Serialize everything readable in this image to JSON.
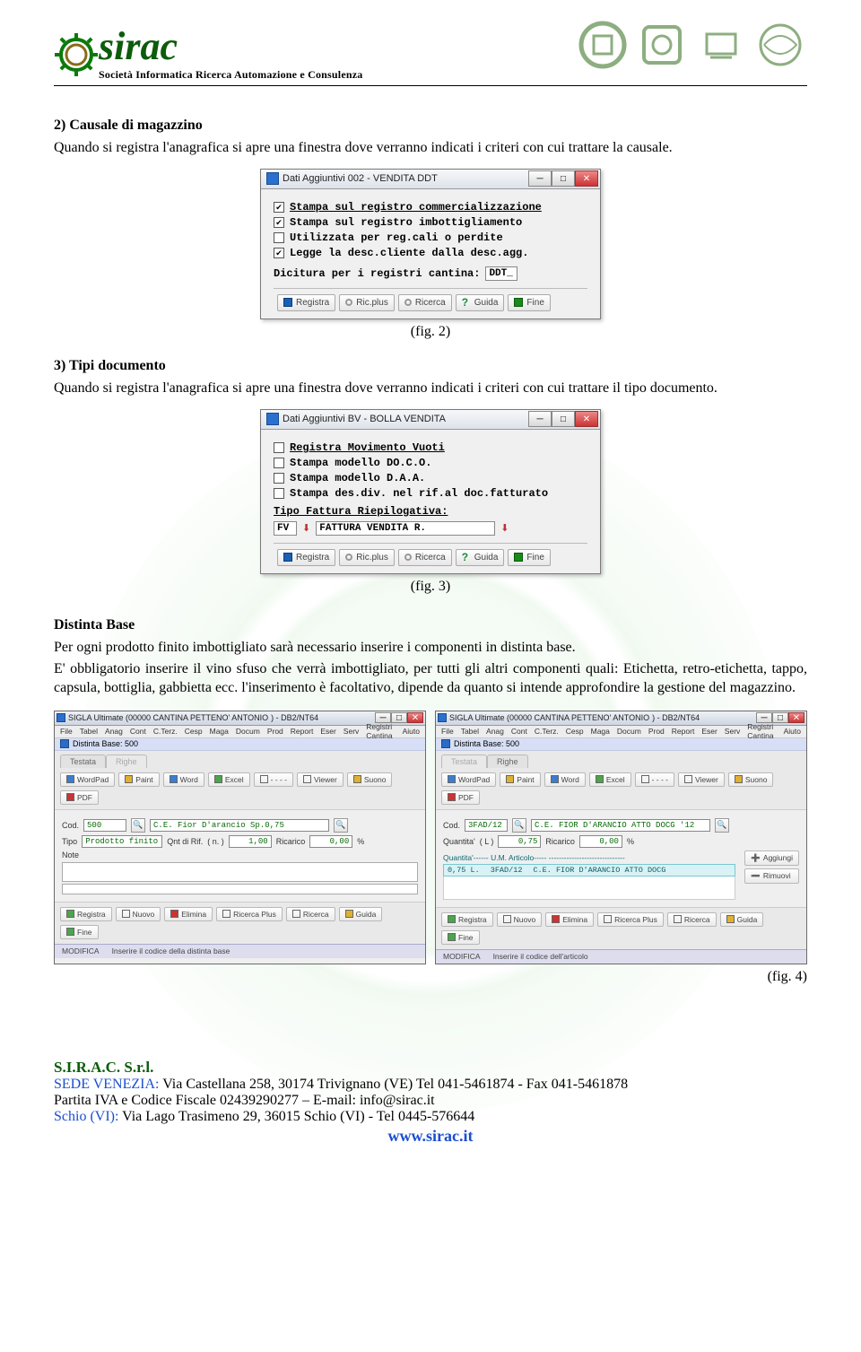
{
  "header": {
    "brand": "sirac",
    "tagline": "Società Informatica Ricerca Automazione e Consulenza"
  },
  "section2": {
    "title": "2)  Causale di magazzino",
    "text": "Quando si registra l'anagrafica si apre una finestra dove verranno indicati i criteri con cui trattare la causale.",
    "fig": "(fig. 2)"
  },
  "section3": {
    "title": "3)  Tipi documento",
    "text": "Quando si registra l'anagrafica si apre una finestra dove verranno indicati i criteri con cui trattare il tipo documento.",
    "fig": "(fig. 3)"
  },
  "distinta": {
    "title": "Distinta Base",
    "p1": "Per ogni prodotto finito imbottigliato sarà necessario inserire i componenti in distinta base.",
    "p2": "E' obbligatorio inserire il vino sfuso che verrà imbottigliato, per tutti gli altri componenti quali: Etichetta, retro-etichetta, tappo, capsula, bottiglia, gabbietta ecc. l'inserimento è facoltativo, dipende da quanto si intende approfondire la gestione del magazzino.",
    "fig": "(fig. 4)"
  },
  "dialog1": {
    "title": "Dati Aggiuntivi 002 - VENDITA DDT",
    "chk1": {
      "label": "Stampa sul registro commercializzazione",
      "checked": true
    },
    "chk2": {
      "label": "Stampa sul registro imbottigliamento",
      "checked": true
    },
    "chk3": {
      "label": "Utilizzata per reg.cali o perdite",
      "checked": false
    },
    "chk4": {
      "label": "Legge la desc.cliente dalla desc.agg.",
      "checked": true
    },
    "dicitura_label": "Dicitura per i registri cantina:",
    "dicitura_value": "DDT_"
  },
  "dialog2": {
    "title": "Dati Aggiuntivi BV - BOLLA VENDITA",
    "chk1": {
      "label": "Registra Movimento Vuoti",
      "checked": false
    },
    "chk2": {
      "label": "Stampa modello DO.C.O.",
      "checked": false
    },
    "chk3": {
      "label": "Stampa modello D.A.A.",
      "checked": false
    },
    "chk4": {
      "label": "Stampa des.div. nel rif.al doc.fatturato",
      "checked": false
    },
    "tipofatt_label": "Tipo Fattura Riepilogativa:",
    "tipo_code": "FV",
    "tipo_desc": "FATTURA VENDITA R."
  },
  "dlgbtns": {
    "registra": "Registra",
    "ricplus": "Ric.plus",
    "ricerca": "Ricerca",
    "guida": "Guida",
    "fine": "Fine"
  },
  "app": {
    "title": "SIGLA Ultimate (00000 CANTINA PETTENO' ANTONIO",
    "title_suffix": ") - DB2/NT64",
    "menu": [
      "File",
      "Tabel",
      "Anag",
      "Cont",
      "C.Terz.",
      "Cesp",
      "Maga",
      "Docum",
      "Prod",
      "Report",
      "Eser",
      "Serv",
      "Registri Cantina",
      "Aiuto"
    ],
    "subbar": "Distinta Base: 500",
    "tab_testata": "Testata",
    "tab_righe": "Righe",
    "tbtn_wordpad": "WordPad",
    "tbtn_paint": "Paint",
    "tbtn_word": "Word",
    "tbtn_excel": "Excel",
    "tbtn_viewer": "Viewer",
    "tbtn_suono": "Suono",
    "tbtn_pdf": "PDF",
    "tbtn_dash": "- - - -"
  },
  "app1": {
    "cod_label": "Cod.",
    "cod_value": "500",
    "cod_desc": "C.E. Fior D'arancio Sp.0,75",
    "tipo_label": "Tipo",
    "tipo_value": "Prodotto finito",
    "qnt_label": "Qnt di Rif.",
    "qnt_unit": "( n. )",
    "qnt_value": "1,00",
    "ric_label": "Ricarico",
    "ric_value": "0,00",
    "ric_pct": "%",
    "note_label": "Note",
    "status_mode": "MODIFICA",
    "status_hint": "Inserire il codice della distinta base"
  },
  "app2": {
    "cod_label": "Cod.",
    "cod_value": "3FAD/12",
    "cod_desc": "C.E. FIOR D'ARANCIO ATTO DOCG '12",
    "qta_label": "Quantita'",
    "qta_unit": "( L )",
    "qta_value": "0,75",
    "ric_label": "Ricarico",
    "ric_value": "0,00",
    "ric_pct": "%",
    "header_row": "Quantita'------ U.M. Articolo----- ------------------------------",
    "detail_qty": "0,75 L.",
    "detail_code": "3FAD/12",
    "detail_desc": "C.E. FIOR D'ARANCIO ATTO DOCG",
    "btn_add": "Aggiungi",
    "btn_rem": "Rimuovi",
    "status_mode": "MODIFICA",
    "status_hint": "Inserire il codice dell'articolo"
  },
  "appbtns": {
    "registra": "Registra",
    "nuovo": "Nuovo",
    "elimina": "Elimina",
    "ricplus": "Ricerca Plus",
    "ricerca": "Ricerca",
    "guida": "Guida",
    "fine": "Fine"
  },
  "footer": {
    "company": "S.I.R.A.C. S.r.l.",
    "l1a": "SEDE VENEZIA: ",
    "l1b": "Via Castellana 258, 30174 Trivignano (VE)  Tel 041-5461874 - Fax 041-5461878",
    "l2": "Partita IVA e Codice Fiscale 02439290277 – E-mail: info@sirac.it",
    "l3a": "Schio (VI): ",
    "l3b": "Via Lago Trasimeno 29, 36015 Schio (VI) - Tel 0445-576644",
    "site": "www.sirac.it"
  }
}
